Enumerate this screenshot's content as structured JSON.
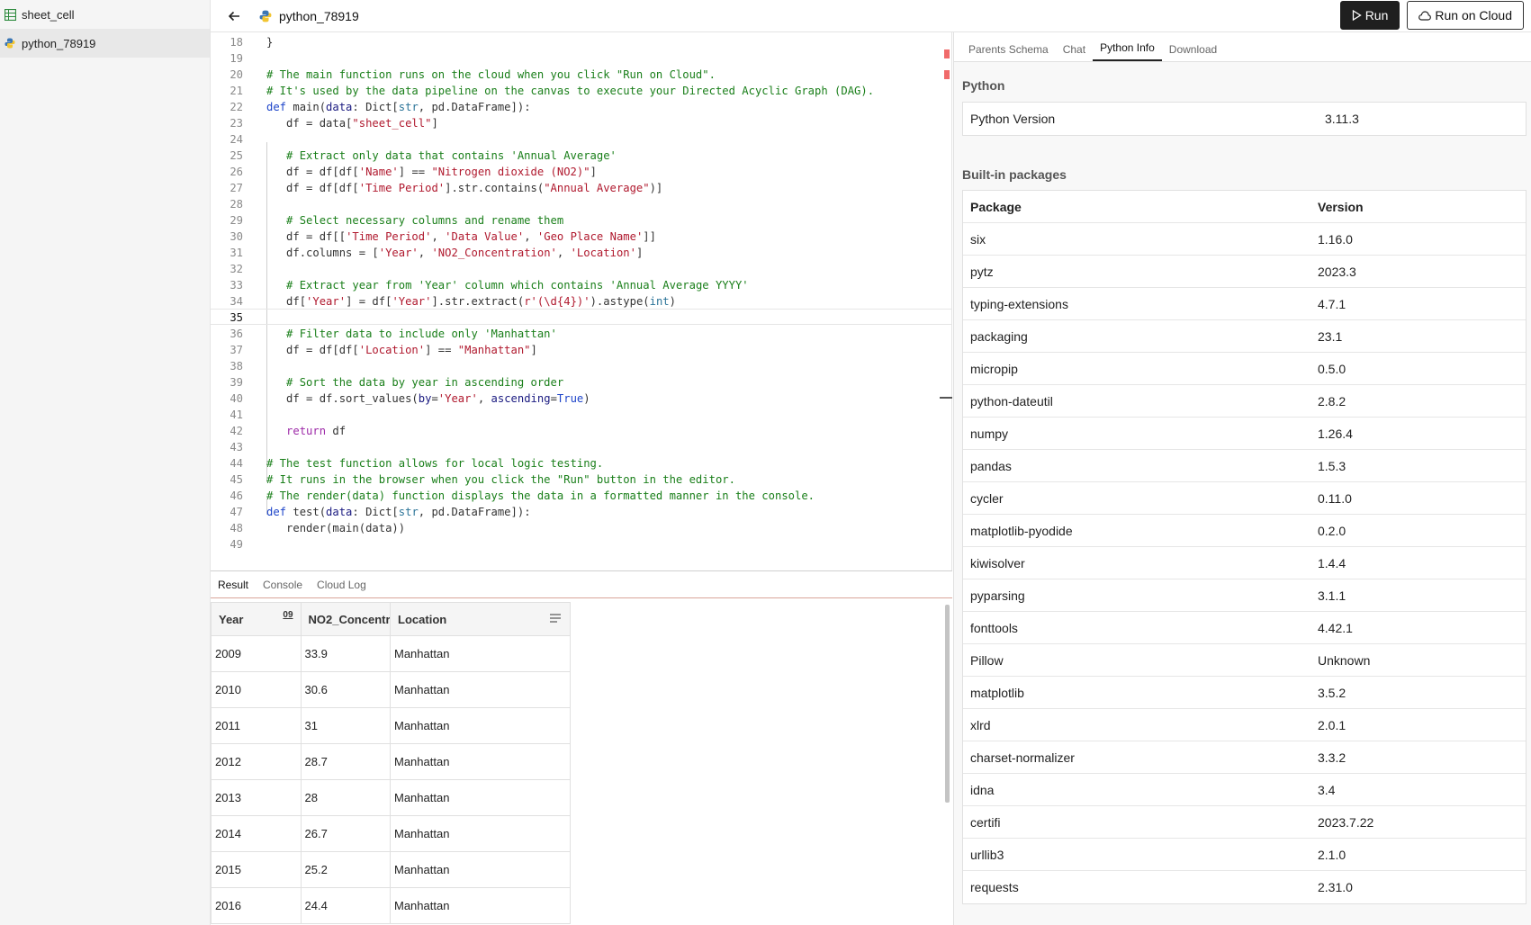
{
  "sidebar": {
    "items": [
      {
        "label": "sheet_cell",
        "icon": "table-icon"
      },
      {
        "label": "python_78919",
        "icon": "python-icon"
      }
    ]
  },
  "topbar": {
    "title": "python_78919",
    "run_label": "Run",
    "run_cloud_label": "Run on Cloud"
  },
  "editor": {
    "current_line": "35"
  },
  "result": {
    "tabs": [
      "Result",
      "Console",
      "Cloud Log"
    ],
    "columns": [
      "Year",
      "NO2_Concentr",
      "Location"
    ],
    "sort_badge": "09",
    "rows": [
      [
        "2009",
        "33.9",
        "Manhattan"
      ],
      [
        "2010",
        "30.6",
        "Manhattan"
      ],
      [
        "2011",
        "31",
        "Manhattan"
      ],
      [
        "2012",
        "28.7",
        "Manhattan"
      ],
      [
        "2013",
        "28",
        "Manhattan"
      ],
      [
        "2014",
        "26.7",
        "Manhattan"
      ],
      [
        "2015",
        "25.2",
        "Manhattan"
      ],
      [
        "2016",
        "24.4",
        "Manhattan"
      ]
    ]
  },
  "right_panel": {
    "tabs": [
      "Parents Schema",
      "Chat",
      "Python Info",
      "Download"
    ],
    "python_title": "Python",
    "python_version_label": "Python Version",
    "python_version": "3.11.3",
    "packages_title": "Built-in packages",
    "pkg_header": [
      "Package",
      "Version"
    ],
    "packages": [
      [
        "six",
        "1.16.0"
      ],
      [
        "pytz",
        "2023.3"
      ],
      [
        "typing-extensions",
        "4.7.1"
      ],
      [
        "packaging",
        "23.1"
      ],
      [
        "micropip",
        "0.5.0"
      ],
      [
        "python-dateutil",
        "2.8.2"
      ],
      [
        "numpy",
        "1.26.4"
      ],
      [
        "pandas",
        "1.5.3"
      ],
      [
        "cycler",
        "0.11.0"
      ],
      [
        "matplotlib-pyodide",
        "0.2.0"
      ],
      [
        "kiwisolver",
        "1.4.4"
      ],
      [
        "pyparsing",
        "3.1.1"
      ],
      [
        "fonttools",
        "4.42.1"
      ],
      [
        "Pillow",
        "Unknown"
      ],
      [
        "matplotlib",
        "3.5.2"
      ],
      [
        "xlrd",
        "2.0.1"
      ],
      [
        "charset-normalizer",
        "3.3.2"
      ],
      [
        "idna",
        "3.4"
      ],
      [
        "certifi",
        "2023.7.22"
      ],
      [
        "urllib3",
        "2.1.0"
      ],
      [
        "requests",
        "2.31.0"
      ]
    ]
  },
  "code": {
    "l18": "}",
    "l20": "# The main function runs on the cloud when you click \"Run on Cloud\".",
    "l21": "# It's used by the data pipeline on the canvas to execute your Directed Acyclic Graph (DAG).",
    "l22_kw": "def",
    "l22_rest": " main(",
    "l22_p": "data",
    "l22_t": ": Dict[",
    "l22_ty": "str",
    "l22_e": ", pd.DataFrame]):",
    "l23_a": "df = data[",
    "l23_s": "\"sheet_cell\"",
    "l23_b": "]",
    "l25": "# Extract only data that contains 'Annual Average'",
    "l26_a": "df = df[df[",
    "l26_s1": "'Name'",
    "l26_b": "] == ",
    "l26_s2": "\"Nitrogen dioxide (NO2)\"",
    "l26_c": "]",
    "l27_a": "df = df[df[",
    "l27_s1": "'Time Period'",
    "l27_b": "].str.contains(",
    "l27_s2": "\"Annual Average\"",
    "l27_c": ")]",
    "l29": "# Select necessary columns and rename them",
    "l30_a": "df = df[[",
    "l30_s1": "'Time Period'",
    "l30_s2": "'Data Value'",
    "l30_s3": "'Geo Place Name'",
    "l30_c": "]]",
    "l31_a": "df.columns = [",
    "l31_s1": "'Year'",
    "l31_s2": "'NO2_Concentration'",
    "l31_s3": "'Location'",
    "l31_c": "]",
    "l33": "# Extract year from 'Year' column which contains 'Annual Average YYYY'",
    "l34_a": "df[",
    "l34_s1": "'Year'",
    "l34_b": "] = df[",
    "l34_c": "].str.extract(",
    "l34_s2": "r'(\\d{4})'",
    "l34_d": ").astype(",
    "l34_ty": "int",
    "l34_e": ")",
    "l36": "# Filter data to include only 'Manhattan'",
    "l37_a": "df = df[df[",
    "l37_s1": "'Location'",
    "l37_b": "] == ",
    "l37_s2": "\"Manhattan\"",
    "l37_c": "]",
    "l39": "# Sort the data by year in ascending order",
    "l40_a": "df = df.sort_values(",
    "l40_p1": "by",
    "l40_s1": "'Year'",
    "l40_p2": "ascending",
    "l40_v": "True",
    "l40_c": ")",
    "l42_kw": "return",
    "l42_r": " df",
    "l44": "# The test function allows for local logic testing.",
    "l45": "# It runs in the browser when you click the \"Run\" button in the editor.",
    "l46": "# The render(data) function displays the data in a formatted manner in the console.",
    "l47_kw": "def",
    "l47_rest": " test(",
    "l47_p": "data",
    "l47_t": ": Dict[",
    "l47_ty": "str",
    "l47_e": ", pd.DataFrame]):",
    "l48": "render(main(data))"
  }
}
